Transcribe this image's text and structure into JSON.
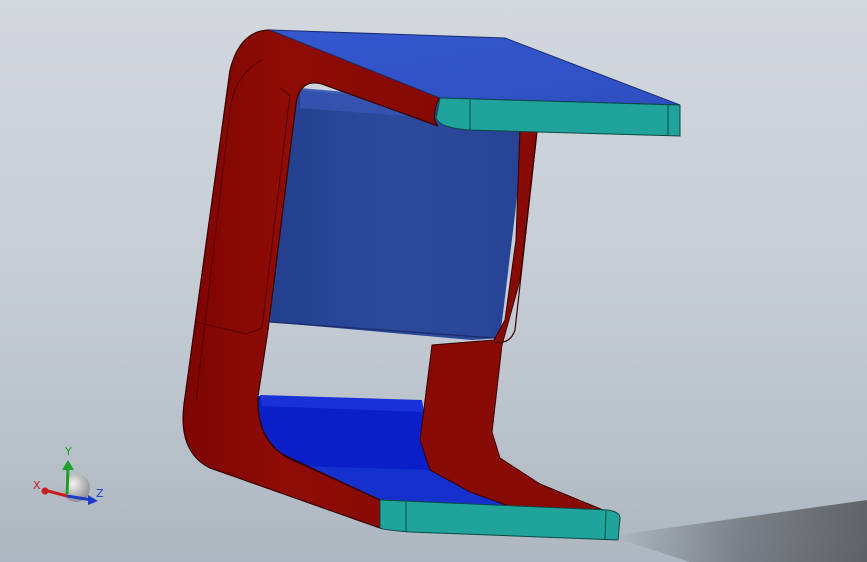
{
  "viewport": {
    "background_top": "#d3d8df",
    "background_bottom": "#aeb7c1"
  },
  "model": {
    "colors": {
      "side_frame": "#8b0a05",
      "side_frame_edge": "#4a0000",
      "top_face": "#2f52c8",
      "inner_back_face": "#2a4696",
      "inner_bottom_face": "#0a1fc8",
      "flange_edge": "#1fa39a"
    }
  },
  "triad": {
    "x_label": "X",
    "y_label": "Y",
    "z_label": "Z",
    "x_color": "#c81e1e",
    "y_color": "#1e9e2a",
    "z_color": "#1e3cc8"
  }
}
